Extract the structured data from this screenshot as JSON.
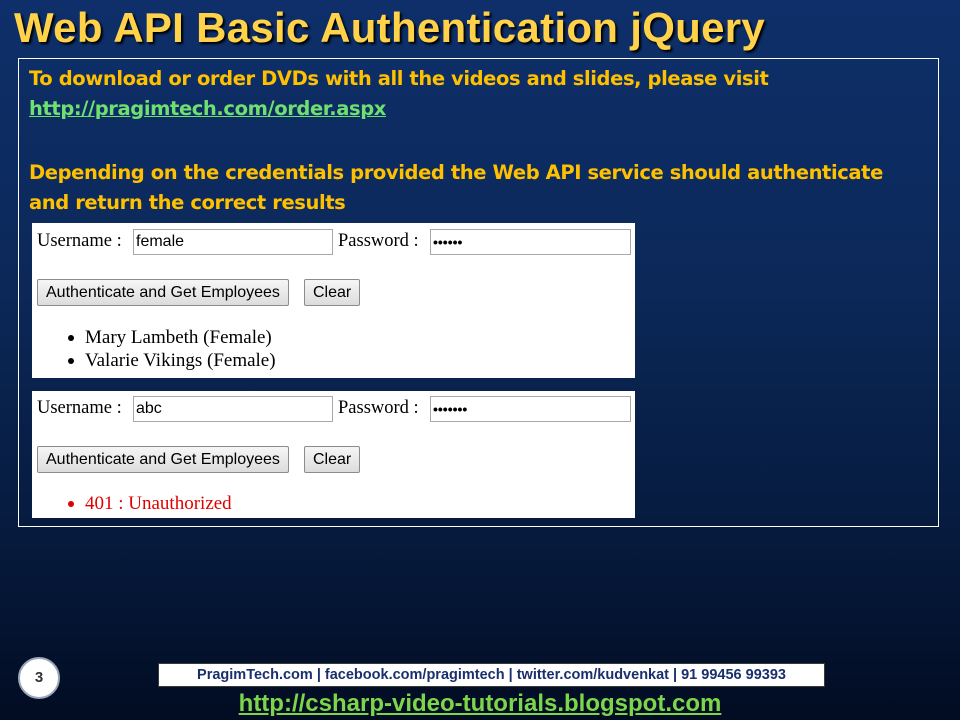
{
  "slide": {
    "title": "Web API Basic Authentication jQuery",
    "page_number": "3"
  },
  "intro": {
    "text": "To download or order DVDs with all the videos and slides, please visit",
    "link": "http://pragimtech.com/order.aspx"
  },
  "description": {
    "line1": "Depending on the credentials provided the Web API service should authenticate",
    "line2": "and return the correct results"
  },
  "panel_success": {
    "username_label": "Username :",
    "username_value": "female",
    "password_label": "Password :",
    "password_value": "••••••",
    "authenticate_button": "Authenticate and Get Employees",
    "clear_button": "Clear",
    "results": [
      "Mary Lambeth (Female)",
      "Valarie Vikings (Female)"
    ]
  },
  "panel_error": {
    "username_label": "Username :",
    "username_value": "abc",
    "password_label": "Password :",
    "password_value": "•••••••",
    "authenticate_button": "Authenticate and Get Employees",
    "clear_button": "Clear",
    "results": [
      "401 : Unauthorized"
    ]
  },
  "footer": {
    "contact_bar": "PragimTech.com | facebook.com/pragimtech | twitter.com/kudvenkat | 91 99456 99393",
    "blog_link": "http://csharp-video-tutorials.blogspot.com"
  },
  "colors": {
    "title": "#ffd24a",
    "text_accent": "#ffc000",
    "link": "#6fe06f",
    "error": "#e00000",
    "background": "#0b2858"
  }
}
